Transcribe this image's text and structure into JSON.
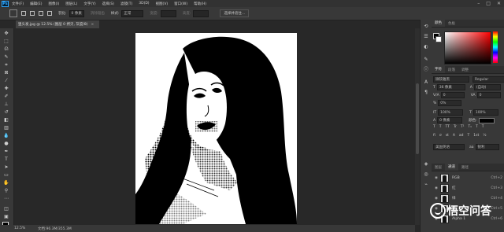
{
  "menubar": {
    "logo": "Ps",
    "items": [
      "文件(F)",
      "编辑(E)",
      "图像(I)",
      "图层(L)",
      "文字(Y)",
      "选择(S)",
      "滤镜(T)",
      "3D(D)",
      "视图(V)",
      "窗口(W)",
      "帮助(H)"
    ],
    "window_controls": [
      "–",
      "□",
      "✕"
    ]
  },
  "optionsbar": {
    "feather_label": "羽化:",
    "feather_value": "0 像素",
    "antialias_label": "消除锯齿",
    "style_label": "样式:",
    "style_value": "正常",
    "width_label": "宽度:",
    "height_label": "高度:",
    "select_mask_button": "选择并遮住..."
  },
  "document": {
    "tab_title": "狙头发.jpg @ 12.5% (图层 0 拷贝, 灰度/8)",
    "tab_close": "×",
    "zoom": "12.5%",
    "doc_info": "文档:96.3M/355.3M"
  },
  "panels": {
    "color_tabs": [
      "颜色",
      "色板"
    ],
    "character_tabs": [
      "字符",
      "段落",
      "调整"
    ],
    "font_family": "微软雅黑",
    "font_style": "Regular",
    "font_size": "36 像素",
    "leading": "(自动)",
    "kerning": "0",
    "tracking": "0",
    "scale_v": "100%",
    "scale_h": "100%",
    "baseline": "0 像素",
    "color_label": "颜色:",
    "language": "美国英语",
    "antialias": "锐利",
    "type_buttons": [
      "T",
      "T",
      "TT",
      "Tr",
      "T¹",
      "T₁",
      "T",
      "T"
    ],
    "layers_tabs": [
      "图层",
      "通道",
      "路径"
    ],
    "channels": [
      {
        "name": "RGB",
        "shortcut": "Ctrl+2"
      },
      {
        "name": "红",
        "shortcut": "Ctrl+3"
      },
      {
        "name": "绿",
        "shortcut": "Ctrl+4"
      },
      {
        "name": "蓝",
        "shortcut": "Ctrl+5"
      },
      {
        "name": "Alpha 1",
        "shortcut": "Ctrl+6"
      }
    ]
  },
  "colors": {
    "ui_dark": "#282828",
    "panel": "#383838",
    "foreground": "#000000",
    "background": "#ffffff"
  },
  "watermark": {
    "text": "悟空问答"
  }
}
